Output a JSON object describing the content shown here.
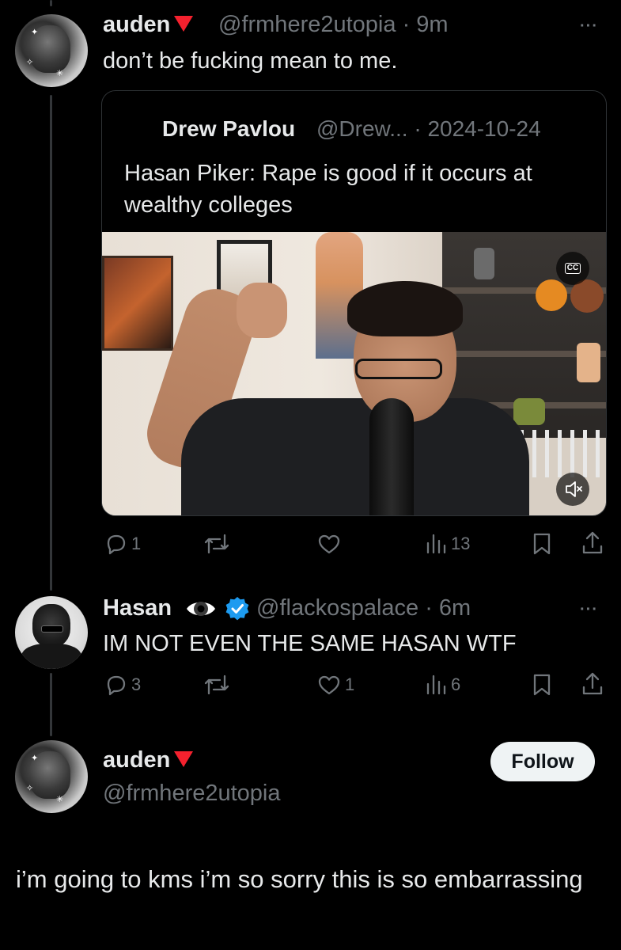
{
  "tweet1": {
    "author": "auden",
    "handle": "@frmhere2utopia",
    "time": "· 9m",
    "text": "don’t be fucking mean to me.",
    "quote": {
      "author": "Drew Pavlou",
      "meta": "@Drew... · 2024-10-24",
      "text": "Hasan Piker: Rape is good if it occurs at wealthy colleges",
      "cc_label": "CC"
    },
    "replies": "1",
    "reposts": "",
    "likes": "",
    "views": "13"
  },
  "tweet2": {
    "author": "Hasan",
    "handle": "@flackospalace",
    "time": "· 6m",
    "text": "IM NOT EVEN THE SAME HASAN WTF",
    "replies": "3",
    "reposts": "",
    "likes": "1",
    "views": "6"
  },
  "main_tweet": {
    "author": "auden",
    "handle": "@frmhere2utopia",
    "follow_label": "Follow",
    "text": "i’m going to kms i’m so sorry this is so embarrassing"
  },
  "more_label": "···",
  "colors": {
    "background": "#000000",
    "text": "#e7e9ea",
    "muted": "#71767b",
    "verified": "#1d9bf0",
    "red_triangle": "#f4212e"
  },
  "icons": [
    "reply-icon",
    "repost-icon",
    "like-icon",
    "views-icon",
    "bookmark-icon",
    "share-icon",
    "verified-badge-icon",
    "eye-emoji-icon",
    "red-triangle-emoji-icon",
    "cc-icon",
    "mute-icon",
    "more-icon"
  ]
}
